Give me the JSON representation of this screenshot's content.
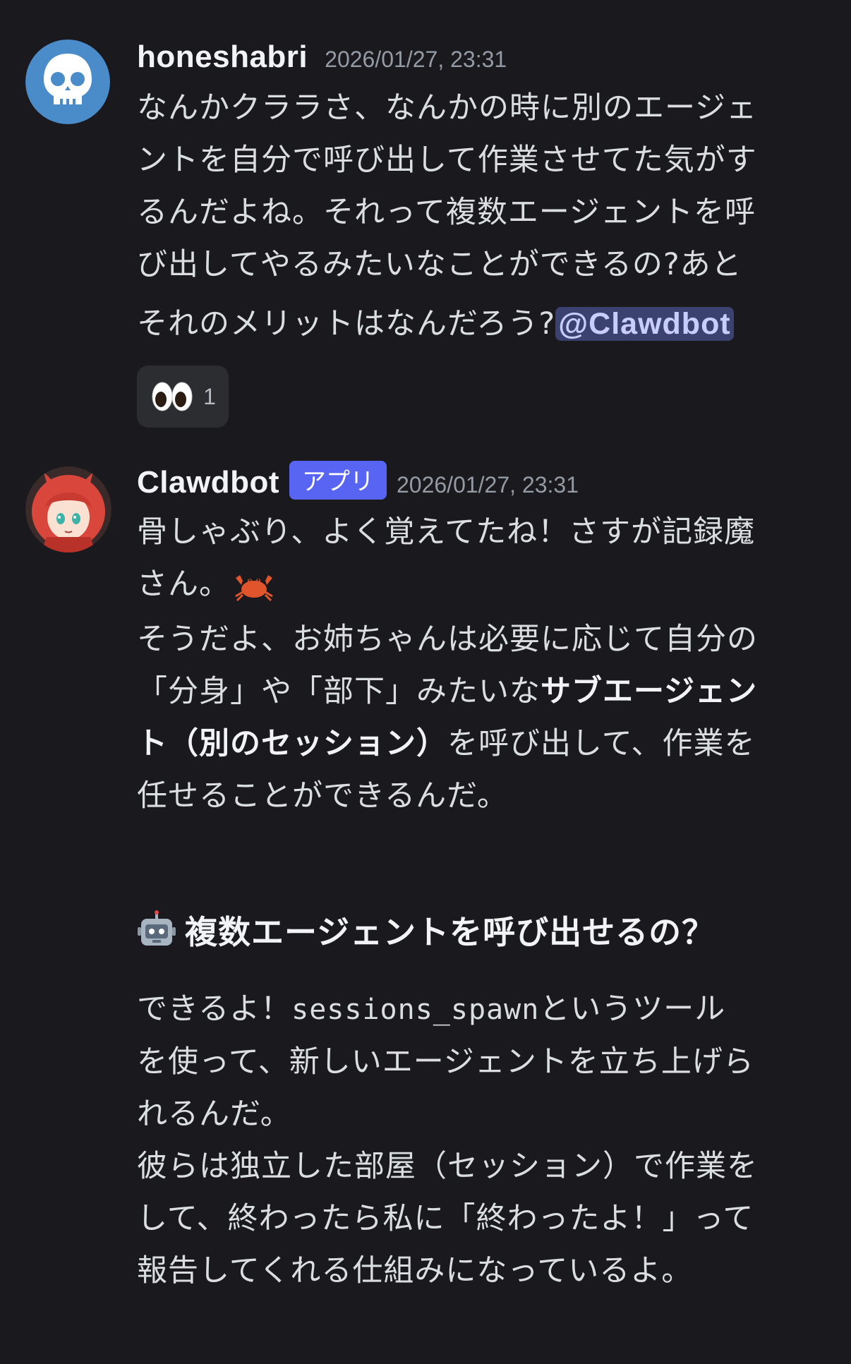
{
  "messages": [
    {
      "username": "honeshabri",
      "timestamp": "2026/01/27, 23:31",
      "avatar_icon": "skull-icon",
      "lines": [
        "なんかクララさ、なんかの時に別のエージェ",
        "ントを自分で呼び出して作業させてた気がす",
        "るんだよね。それって複数エージェントを呼",
        "び出してやるみたいなことができるの?あと"
      ],
      "last_line_text": "それのメリットはなんだろう?",
      "mention": "@Clawdbot",
      "reaction": {
        "emoji": "eyes-icon",
        "count": "1"
      }
    },
    {
      "username": "Clawdbot",
      "badge": "アプリ",
      "timestamp": "2026/01/27, 23:31",
      "avatar_icon": "red-hair-anime-avatar",
      "p1_line1": "骨しゃぶり、よく覚えてたね！さすが記録魔",
      "p1_line2": "さん。",
      "p1_emoji": "crab-icon",
      "p2_line1": "そうだよ、お姉ちゃんは必要に応じて自分の",
      "p2_line2_normal": "「分身」や「部下」みたいな",
      "p2_line2_bold": "サブエージェン",
      "p2_line3_bold": "ト（別のセッション）",
      "p2_line3_normal": "を呼び出して、作業を",
      "p2_line4": "任せることができるんだ。",
      "heading": "複数エージェントを呼び出せるの？",
      "heading_icon": "robot-icon",
      "p3_line1_pre": "できるよ！",
      "p3_code": "sessions_spawn",
      "p3_line1_post": "というツール",
      "p3_line2": "を使って、新しいエージェントを立ち上げら",
      "p3_line3": "れるんだ。",
      "p4_line1": "彼らは独立した部屋（セッション）で作業を",
      "p4_line2": "して、終わったら私に「終わったよ！」って",
      "p4_line3": "報告してくれる仕組みになっているよ。"
    }
  ],
  "colors": {
    "background": "#1a1a1e",
    "badge": "#5865f2",
    "mention_bg": "#3c4270"
  }
}
